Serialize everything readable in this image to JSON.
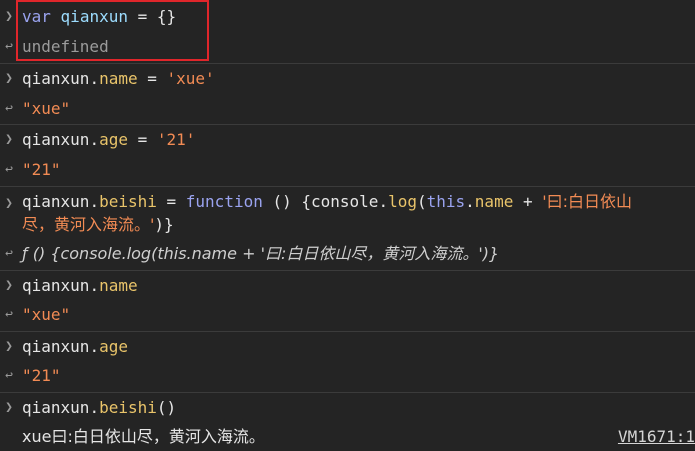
{
  "entries": [
    {
      "input": {
        "kw": "var",
        "name": "qianxun",
        "rest": " = {}"
      },
      "output": "undefined"
    },
    {
      "input": {
        "obj": "qianxun",
        "prop": "name",
        "op": " = ",
        "value": "'xue'"
      },
      "output": "\"xue\""
    },
    {
      "input": {
        "obj": "qianxun",
        "prop": "age",
        "op": " = ",
        "value": "'21'"
      },
      "output": "\"21\""
    },
    {
      "input": {
        "obj": "qianxun",
        "prop": "beishi",
        "op": " = ",
        "kw": "function",
        "paren": " () {console.",
        "method": "log",
        "open": "(",
        "this": "this",
        "dot": ".",
        "name": "name",
        "plus": " + ",
        "str_line1": "'曰:白日依山",
        "str_line2": "尽，黄河入海流。'",
        "close": ")}"
      },
      "output": "ƒ () {console.log(this.name + '曰:白日依山尽，黄河入海流。')}"
    },
    {
      "input": {
        "obj": "qianxun",
        "prop": "name"
      },
      "output": "\"xue\""
    },
    {
      "input": {
        "obj": "qianxun",
        "prop": "age"
      },
      "output": "\"21\""
    },
    {
      "input": {
        "obj": "qianxun",
        "prop": "beishi",
        "call": "()"
      },
      "output": "xue曰:白日依山尽，黄河入海流。",
      "source": "VM1671:1"
    }
  ],
  "icons": {
    "prompt": "chevron-right-icon",
    "result": "result-arrow-icon"
  },
  "colors": {
    "background": "#242424",
    "highlight_border": "#e0262b",
    "property": "#e9c46a",
    "string": "#f28b54",
    "keyword": "#9aa3ef"
  }
}
